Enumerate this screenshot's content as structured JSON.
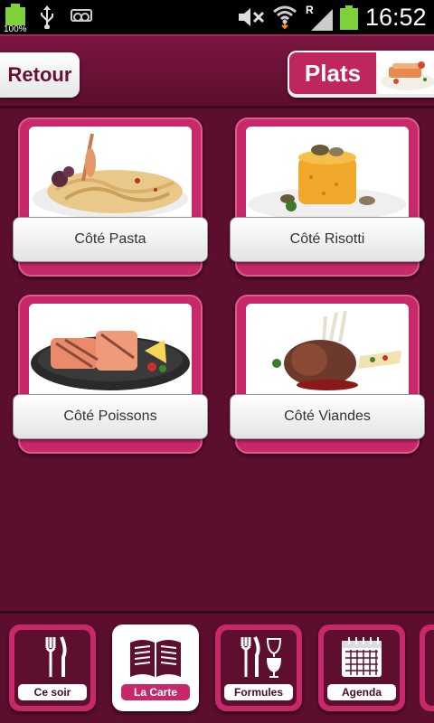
{
  "status_bar": {
    "battery_left_label": "100%",
    "time": "16:52",
    "network_label": "R",
    "icons": [
      "battery-icon",
      "usb-icon",
      "voicemail-icon",
      "mute-icon",
      "wifi-icon",
      "signal-icon",
      "battery-icon"
    ]
  },
  "header": {
    "back_label": "Retour",
    "title": "Plats"
  },
  "categories": [
    {
      "label": "Côté Pasta"
    },
    {
      "label": "Côté Risotti"
    },
    {
      "label": "Côté Poissons"
    },
    {
      "label": "Côté Viandes"
    }
  ],
  "bottom_nav": {
    "items": [
      {
        "label": "Ce soir",
        "icon": "cutlery-icon",
        "active": false
      },
      {
        "label": "La Carte",
        "icon": "book-icon",
        "active": true
      },
      {
        "label": "Formules",
        "icon": "cutlery-wine-icon",
        "active": false
      },
      {
        "label": "Agenda",
        "icon": "calendar-icon",
        "active": false
      }
    ]
  },
  "colors": {
    "background": "#5c0e2e",
    "accent": "#c6286a",
    "button_text": "#6b0f36"
  }
}
